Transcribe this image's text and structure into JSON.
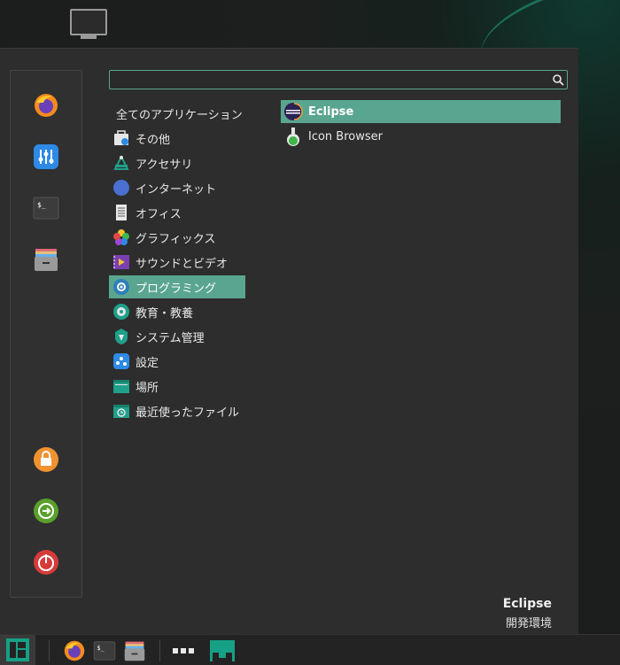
{
  "search": {
    "value": "",
    "placeholder": ""
  },
  "favorites": [
    {
      "name": "firefox"
    },
    {
      "name": "settings"
    },
    {
      "name": "terminal"
    },
    {
      "name": "file-manager"
    },
    {
      "name": "lock-screen"
    },
    {
      "name": "logout"
    },
    {
      "name": "shutdown"
    }
  ],
  "categories": [
    {
      "label": "全てのアプリケーション",
      "icon": "none"
    },
    {
      "label": "その他",
      "icon": "misc-icon"
    },
    {
      "label": "アクセサリ",
      "icon": "accessories-icon"
    },
    {
      "label": "インターネット",
      "icon": "internet-icon"
    },
    {
      "label": "オフィス",
      "icon": "office-icon"
    },
    {
      "label": "グラフィックス",
      "icon": "graphics-icon"
    },
    {
      "label": "サウンドとビデオ",
      "icon": "multimedia-icon"
    },
    {
      "label": "プログラミング",
      "icon": "programming-icon",
      "selected": true
    },
    {
      "label": "教育・教養",
      "icon": "education-icon"
    },
    {
      "label": "システム管理",
      "icon": "system-icon"
    },
    {
      "label": "設定",
      "icon": "settings-icon"
    },
    {
      "label": "場所",
      "icon": "places-icon"
    },
    {
      "label": "最近使ったファイル",
      "icon": "recent-icon"
    }
  ],
  "apps": [
    {
      "label": "Eclipse",
      "icon": "eclipse-icon",
      "selected": true
    },
    {
      "label": "Icon Browser",
      "icon": "flask-icon"
    }
  ],
  "description": {
    "title": "Eclipse",
    "subtitle": "開発環境"
  },
  "colors": {
    "accent": "#5aa58f",
    "menu_bg": "#2d2d2d",
    "taskbar_bg": "#232323"
  }
}
